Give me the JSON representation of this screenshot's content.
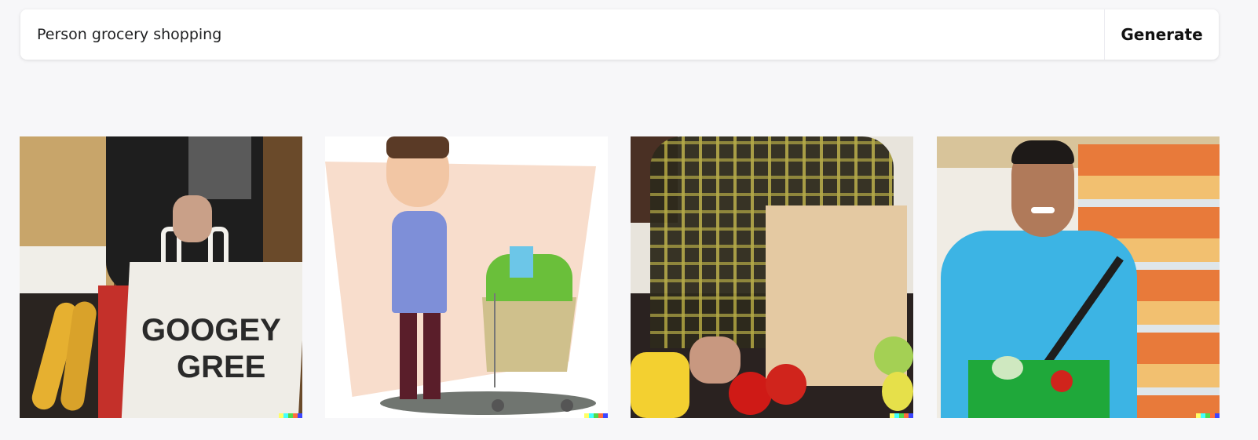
{
  "search": {
    "value": "Person grocery shopping",
    "placeholder": "",
    "button_label": "Generate"
  },
  "images": [
    {
      "bag_text_line1": "GOOGEY",
      "bag_text_line2": "GREE"
    },
    {},
    {},
    {}
  ],
  "watermark_colors": [
    "#ffff66",
    "#42ffff",
    "#51da4c",
    "#ff6e3c",
    "#3c46ff"
  ]
}
